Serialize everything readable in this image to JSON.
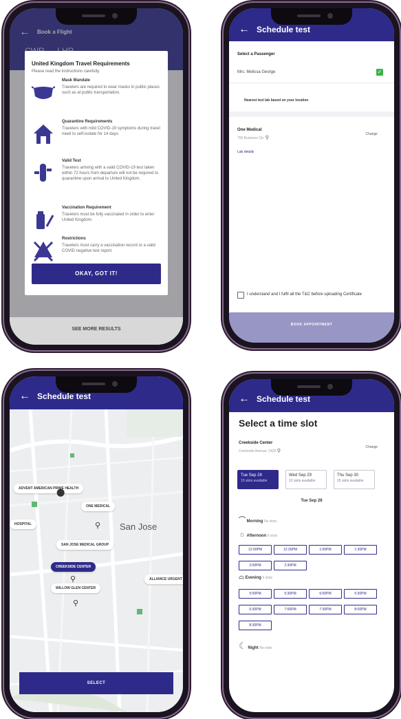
{
  "phone1": {
    "title": "Book a Flight",
    "route": "CWR → LHR",
    "modal_title": "United Kingdom Travel Requirements",
    "modal_subtitle": "Please read the instructions carefully.",
    "items": [
      {
        "title": "Mask Mandate",
        "desc": "Travelers are required to wear masks in public places such as at public transportation.",
        "icon": "face-mask-icon"
      },
      {
        "title": "Quarantine Requirements",
        "desc": "Travelers with mild COVID-19 symptoms during travel need to self-isolate for 14 days.",
        "icon": "house-icon"
      },
      {
        "title": "Valid Test",
        "desc": "Travelers arriving with a valid COVID-19 test taken within 72 hours from departure will not be required to quarantine upon arrival to United Kingdom.",
        "icon": "test-tube-icon"
      },
      {
        "title": "Vaccination Requirement",
        "desc": "Travelers must be fully vaccinated in order to enter United Kingdom.",
        "icon": "vaccine-icon"
      },
      {
        "title": "Restrictions",
        "desc": "Travelers must carry a vaccination record or a valid COVID negative test report.",
        "icon": "restriction-icon"
      }
    ],
    "cta": "OKAY, GOT IT!",
    "bottom": "SEE MORE RESULTS"
  },
  "phone2": {
    "title": "Schedule test",
    "select_passenger": "Select a Passenger",
    "passenger": "Mrs. Melissa George",
    "nearest": "Nearest test lab based on your location",
    "lab_name": "One Medical",
    "lab_addr": "755 Business Ctr.",
    "change": "Change",
    "details": "Lab details",
    "consent": "I understand and I fulfil all the T&C before uploading Certificate",
    "cta": "BOOK APPOINTMENT"
  },
  "phone3": {
    "title": "Schedule test",
    "labels": [
      "ADVENT AMERICAN PRIME HEALTH",
      "ONE MEDICAL",
      "SAN JOSE MEDICAL GROUP",
      "CREEKSIDE CENTER",
      "WILLOW GLEN CENTER",
      "ALLIANCE URGENT CARE",
      "HOSPITAL"
    ],
    "city": "San Jose",
    "cta": "SELECT"
  },
  "phone4": {
    "title": "Schedule test",
    "heading": "Select a time slot",
    "center": "Creekside Center",
    "center_addr": "Creekside Avenue, 1420",
    "change": "Change",
    "dates": [
      {
        "day": "Tue Sep 28",
        "sub": "10 slots available"
      },
      {
        "day": "Wed Sep 29",
        "sub": "12 slots available"
      },
      {
        "day": "Thu Sep 30",
        "sub": "15 slots available"
      }
    ],
    "selected_date": "Tue Sep 28",
    "morning": "Morning",
    "morning_sub": "No slots",
    "afternoon": "Afternoon",
    "afternoon_sub": "6 slots",
    "afternoon_slots": [
      "12:00PM",
      "12:30PM",
      "1:00PM",
      "1:30PM",
      "2:00PM",
      "2:30PM"
    ],
    "evening": "Evening",
    "evening_sub": "9 slots",
    "evening_slots": [
      "5:00PM",
      "5:30PM",
      "6:00PM",
      "6:30PM",
      "6:30PM",
      "7:00PM",
      "7:30PM",
      "8:00PM",
      "8:30PM"
    ],
    "night": "Night",
    "night_sub": "No slots"
  },
  "colors": {
    "primary": "#2e2a8a",
    "check": "#3cb34a",
    "map_green": "#5fb878"
  }
}
